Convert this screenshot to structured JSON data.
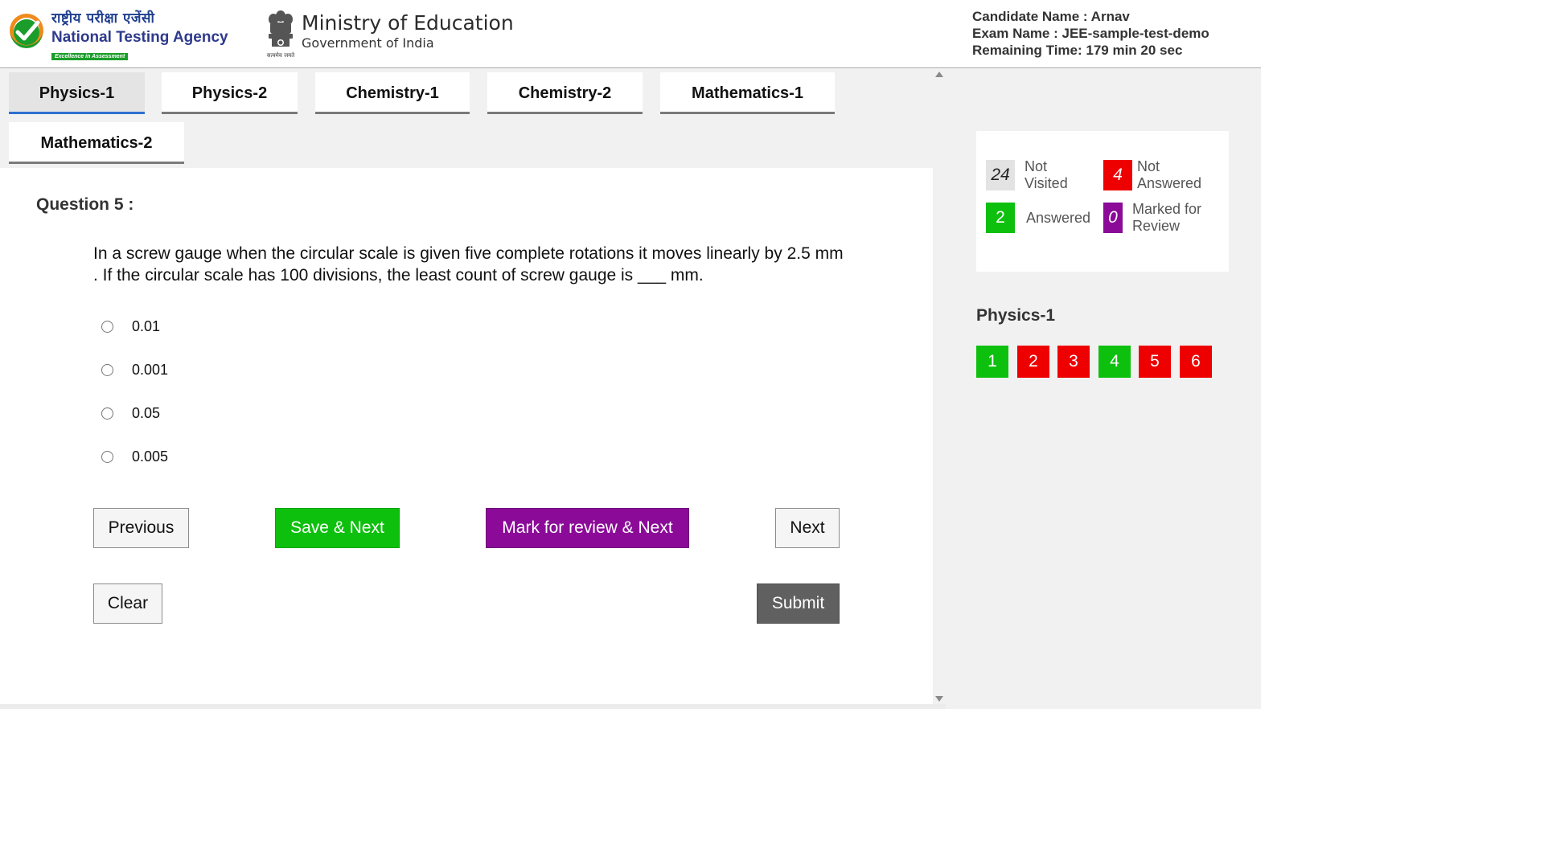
{
  "header": {
    "nta_hindi": "राष्ट्रीय परीक्षा एजेंसी",
    "nta_name": "National Testing Agency",
    "nta_tagline": "Excellence in Assessment",
    "ministry_title": "Ministry of Education",
    "ministry_sub": "Government of India",
    "emblem_motto": "सत्यमेव जयते",
    "candidate_name": "Candidate Name : Arnav",
    "exam_name": "Exam Name : JEE-sample-test-demo",
    "remaining_time": "Remaining Time: 179 min 20 sec"
  },
  "tabs": [
    {
      "label": "Physics-1",
      "active": true
    },
    {
      "label": "Physics-2",
      "active": false
    },
    {
      "label": "Chemistry-1",
      "active": false
    },
    {
      "label": "Chemistry-2",
      "active": false
    },
    {
      "label": "Mathematics-1",
      "active": false
    },
    {
      "label": "Mathematics-2",
      "active": false
    }
  ],
  "question": {
    "title": "Question 5 :",
    "text": "In a screw gauge when the circular scale is given five complete rotations it moves linearly by 2.5 mm . If the circular scale has 100 divisions, the least count of screw gauge is ___ mm.",
    "options": [
      "0.01",
      "0.001",
      "0.05",
      "0.005"
    ]
  },
  "buttons": {
    "previous": "Previous",
    "save_next": "Save & Next",
    "mark_review_next": "Mark for review & Next",
    "next": "Next",
    "clear": "Clear",
    "submit": "Submit"
  },
  "legend": {
    "not_visited": {
      "count": "24",
      "label": "Not Visited"
    },
    "not_answered": {
      "count": "4",
      "label": "Not Answered"
    },
    "answered": {
      "count": "2",
      "label": "Answered"
    },
    "marked_review": {
      "count": "0",
      "label": "Marked for Review"
    }
  },
  "palette": {
    "section_title": "Physics-1",
    "questions": [
      {
        "number": "1",
        "status": "answered"
      },
      {
        "number": "2",
        "status": "not_answered"
      },
      {
        "number": "3",
        "status": "not_answered"
      },
      {
        "number": "4",
        "status": "answered"
      },
      {
        "number": "5",
        "status": "not_answered"
      },
      {
        "number": "6",
        "status": "not_answered"
      }
    ]
  },
  "colors": {
    "answered": "#0ec00e",
    "not_answered": "#ee0000",
    "marked_review": "#8b0b98",
    "not_visited": "#e3e3e3",
    "active_tab_underline": "#2f6fd1"
  }
}
